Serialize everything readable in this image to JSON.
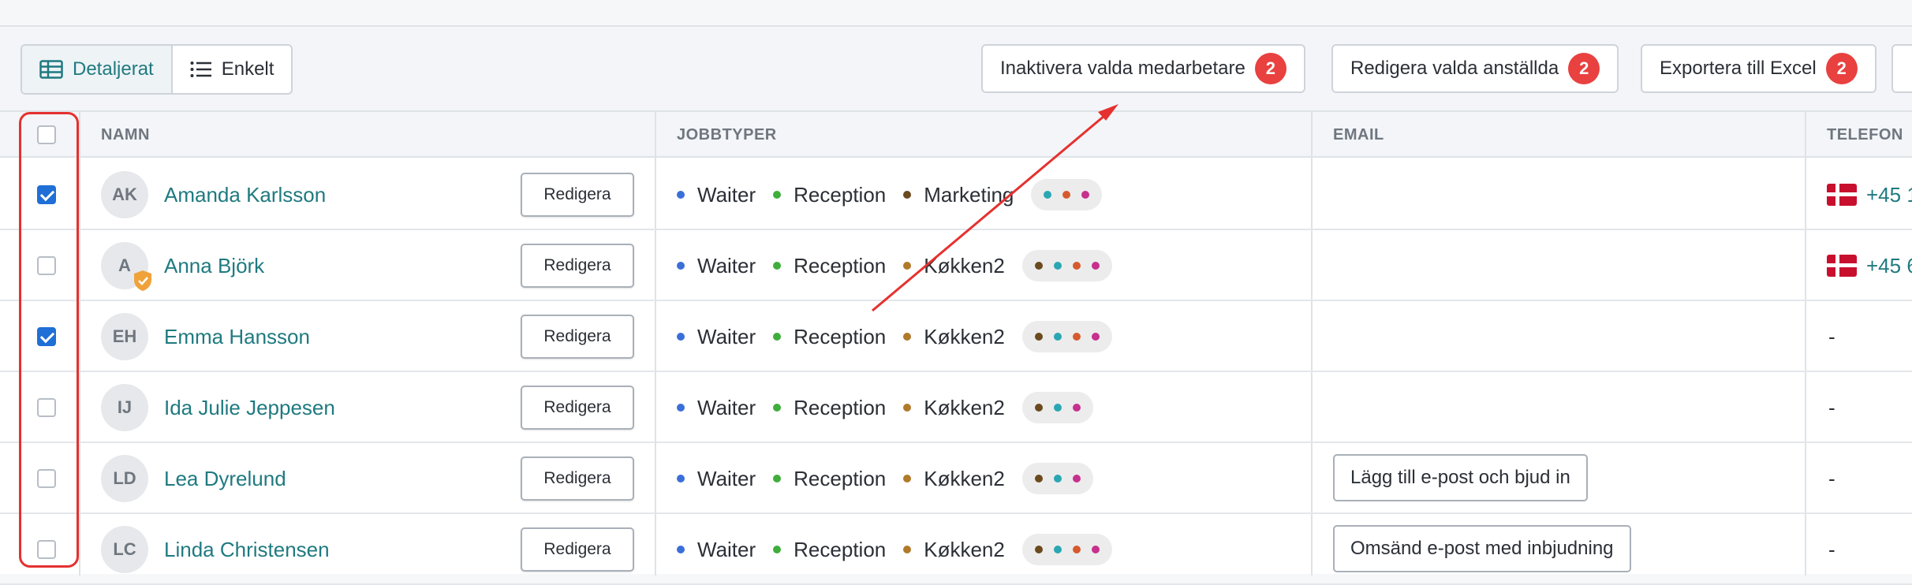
{
  "view_toggle": {
    "detailed": "Detaljerat",
    "simple": "Enkelt"
  },
  "actions": [
    {
      "label": "Inaktivera valda medarbetare",
      "count": "2"
    },
    {
      "label": "Redigera valda anställda",
      "count": "2"
    },
    {
      "label": "Exportera till Excel",
      "count": "2"
    }
  ],
  "columns": {
    "name": "NAMN",
    "jobtypes": "JOBBTYPER",
    "email": "EMAIL",
    "phone": "TELEFON"
  },
  "edit_label": "Redigera",
  "jobtype_colors": {
    "Waiter": "#3a6fd8",
    "Reception": "#3fae3a",
    "Marketing": "#6b4a1e",
    "Køkken2": "#b07a2a"
  },
  "rows": [
    {
      "initials": "AK",
      "name": "Amanda Karlsson",
      "checked": true,
      "verified": false,
      "jobs": [
        "Waiter",
        "Reception",
        "Marketing"
      ],
      "extra_dots": [
        "#2aa7b2",
        "#d65a2e",
        "#c7308e"
      ],
      "email_action": "",
      "phone": "+45 1"
    },
    {
      "initials": "A",
      "name": "Anna Björk",
      "checked": false,
      "verified": true,
      "jobs": [
        "Waiter",
        "Reception",
        "Køkken2"
      ],
      "extra_dots": [
        "#6b4a1e",
        "#2aa7b2",
        "#d65a2e",
        "#c7308e"
      ],
      "email_action": "",
      "phone": "+45 6"
    },
    {
      "initials": "EH",
      "name": "Emma Hansson",
      "checked": true,
      "verified": false,
      "jobs": [
        "Waiter",
        "Reception",
        "Køkken2"
      ],
      "extra_dots": [
        "#6b4a1e",
        "#2aa7b2",
        "#d65a2e",
        "#c7308e"
      ],
      "email_action": "",
      "phone": "-"
    },
    {
      "initials": "IJ",
      "name": "Ida Julie Jeppesen",
      "checked": false,
      "verified": false,
      "jobs": [
        "Waiter",
        "Reception",
        "Køkken2"
      ],
      "extra_dots": [
        "#6b4a1e",
        "#2aa7b2",
        "#c7308e"
      ],
      "email_action": "",
      "phone": "-"
    },
    {
      "initials": "LD",
      "name": "Lea Dyrelund",
      "checked": false,
      "verified": false,
      "jobs": [
        "Waiter",
        "Reception",
        "Køkken2"
      ],
      "extra_dots": [
        "#6b4a1e",
        "#2aa7b2",
        "#c7308e"
      ],
      "email_action": "Lägg till e-post och bjud in",
      "phone": "-"
    },
    {
      "initials": "LC",
      "name": "Linda Christensen",
      "checked": false,
      "verified": false,
      "jobs": [
        "Waiter",
        "Reception",
        "Køkken2"
      ],
      "extra_dots": [
        "#6b4a1e",
        "#2aa7b2",
        "#d65a2e",
        "#c7308e"
      ],
      "email_action": "Omsänd e-post med inbjudning",
      "phone": "-"
    }
  ]
}
